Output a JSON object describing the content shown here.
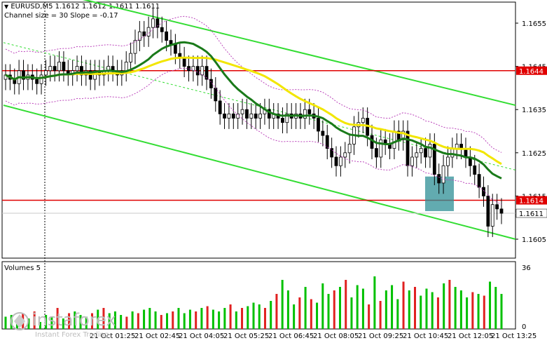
{
  "header": {
    "symbol_line": "EURUSD,M5  1.1612 1.1612 1.1611 1.1611",
    "channel_line": "Channel size = 30 Slope = -0.17"
  },
  "volume_title": "Volumes 5",
  "watermark": {
    "brand": "instaforex",
    "tagline": "Instant Forex Trading"
  },
  "chart_data": [
    {
      "type": "candlestick",
      "symbol": "EURUSD",
      "timeframe": "M5",
      "ohlc_last": {
        "open": 1.1612,
        "high": 1.1612,
        "low": 1.1611,
        "close": 1.1611
      },
      "ylim": [
        1.16,
        1.1662
      ],
      "yticks": [
        "1.1655",
        "1.1645",
        "1.1635",
        "1.1625",
        "1.1615",
        "1.1605"
      ],
      "xticks": [
        "21 Oct 02:45",
        "21 Oct 04:05",
        "21 Oct 05:25",
        "21 Oct 06:45",
        "21 Oct 08:05",
        "21 Oct 09:25",
        "21 Oct 10:45",
        "21 Oct 12:05",
        "21 Oct 13:25"
      ],
      "xticks_partially_hidden": [
        "21 Oct 01:25"
      ],
      "levels": [
        {
          "label": "1.1644",
          "price": 1.1644,
          "color": "#e00000"
        },
        {
          "label": "1.1614",
          "price": 1.1614,
          "color": "#e00000"
        }
      ],
      "current_price_label": "1.1611",
      "current_price": 1.1611,
      "colors": {
        "up_candle": "#000000",
        "down_candle": "#000000",
        "fast_ma": "#1a7a1a",
        "slow_ma": "#f2e600",
        "channel": "#33dd33",
        "highlight_box": "#2e8f96"
      },
      "close_series": [
        1.1643,
        1.1642,
        1.1641,
        1.1644,
        1.1642,
        1.1643,
        1.1642,
        1.1641,
        1.1643,
        1.1644,
        1.1645,
        1.1644,
        1.1646,
        1.1644,
        1.1643,
        1.1644,
        1.1645,
        1.1643,
        1.1644,
        1.1642,
        1.1644,
        1.1643,
        1.1644,
        1.1645,
        1.1644,
        1.1643,
        1.1644,
        1.1646,
        1.1648,
        1.1651,
        1.1653,
        1.1652,
        1.1654,
        1.1656,
        1.1654,
        1.1653,
        1.1651,
        1.165,
        1.1648,
        1.1647,
        1.1645,
        1.1644,
        1.1645,
        1.1643,
        1.1645,
        1.1642,
        1.164,
        1.1637,
        1.1634,
        1.1633,
        1.1634,
        1.1633,
        1.1634,
        1.1635,
        1.1633,
        1.1634,
        1.1633,
        1.1634,
        1.1635,
        1.1633,
        1.1634,
        1.1633,
        1.1632,
        1.1634,
        1.1633,
        1.1634,
        1.1633,
        1.1635,
        1.1634,
        1.1633,
        1.163,
        1.1629,
        1.1626,
        1.1624,
        1.1622,
        1.1624,
        1.1625,
        1.1627,
        1.1631,
        1.1632,
        1.1633,
        1.1629,
        1.1626,
        1.1624,
        1.1628,
        1.1627,
        1.1626,
        1.163,
        1.1628,
        1.163,
        1.1622,
        1.1624,
        1.1625,
        1.1626,
        1.1624,
        1.1627,
        1.162,
        1.1618,
        1.1622,
        1.1624,
        1.1626,
        1.1627,
        1.1626,
        1.1624,
        1.1622,
        1.162,
        1.1617,
        1.1615,
        1.1608,
        1.1613,
        1.1612,
        1.1611
      ],
      "series": [
        {
          "values": [],
          "note_key": "fast_ma"
        },
        {
          "values": [],
          "note_key": "slow_ma"
        }
      ]
    },
    {
      "type": "bar",
      "title": "Volumes 5",
      "ylim": [
        0,
        36
      ],
      "yticks": [
        "36",
        "0"
      ],
      "values": [
        7,
        8,
        5,
        9,
        6,
        10,
        4,
        8,
        7,
        12,
        6,
        9,
        10,
        8,
        7,
        9,
        11,
        12,
        9,
        10,
        8,
        7,
        10,
        9,
        11,
        12,
        10,
        8,
        9,
        10,
        12,
        9,
        11,
        10,
        12,
        13,
        11,
        10,
        12,
        14,
        10,
        12,
        13,
        15,
        14,
        12,
        16,
        20,
        28,
        22,
        14,
        18,
        24,
        17,
        15,
        26,
        20,
        22,
        24,
        28,
        18,
        25,
        23,
        14,
        30,
        16,
        22,
        25,
        17,
        27,
        22,
        24,
        19,
        23,
        21,
        18,
        26,
        28,
        24,
        22,
        18,
        21,
        20,
        19,
        27,
        24,
        20
      ]
    }
  ]
}
